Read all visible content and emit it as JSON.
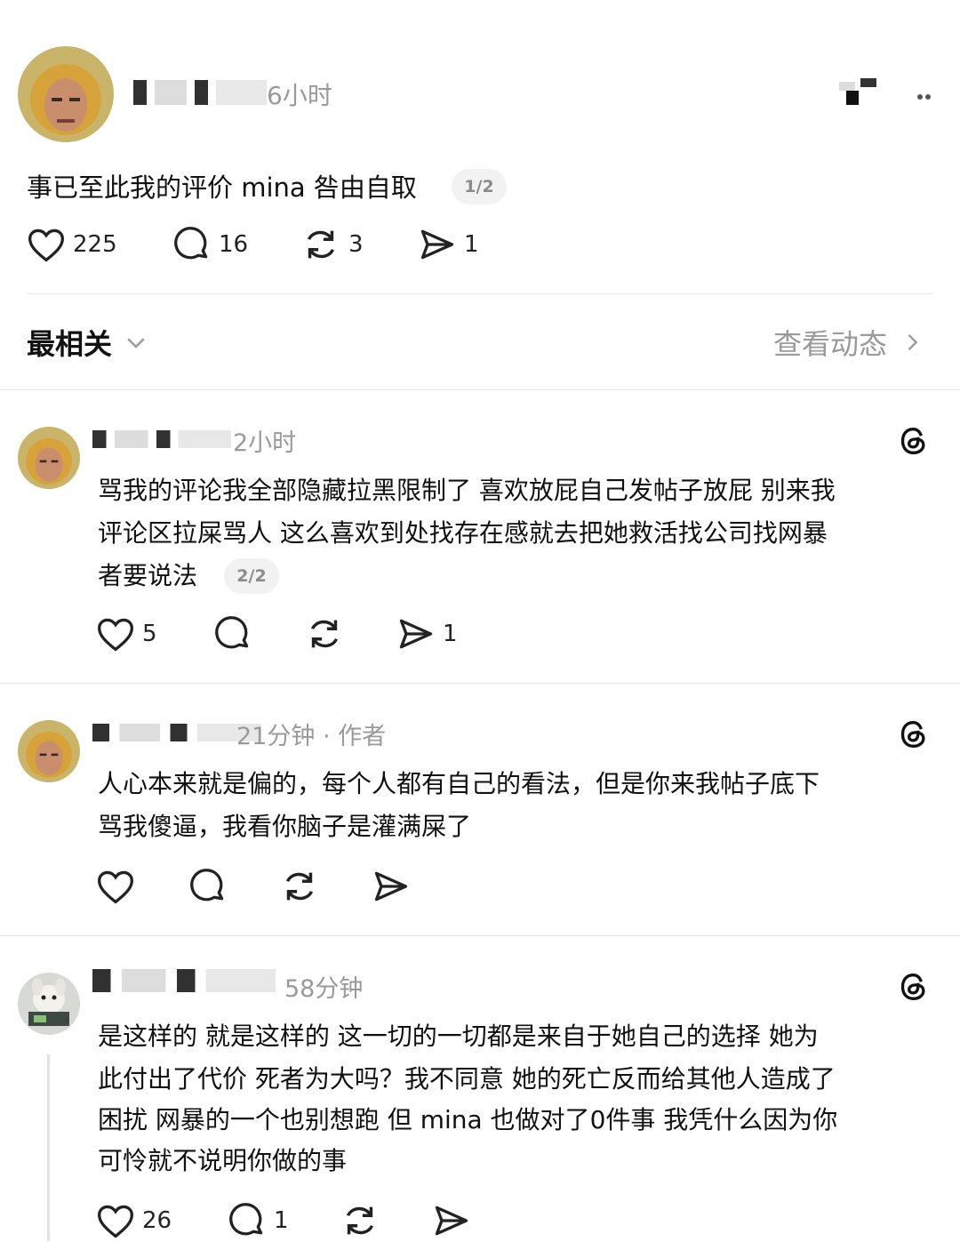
{
  "post": {
    "time": "6小时",
    "text": "事已至此我的评价 mina 咎由自取",
    "page": "1/2",
    "likes": "225",
    "comments": "16",
    "reposts": "3",
    "shares": "1"
  },
  "sort": {
    "label": "最相关",
    "view_activity": "查看动态"
  },
  "replies": [
    {
      "time": "2小时",
      "text_lines": [
        "骂我的评论我全部隐藏拉黑限制了 喜欢放屁自己发帖子放屁 别来我",
        "评论区拉屎骂人 这么喜欢到处找存在感就去把她救活找公司找网暴",
        "者要说法"
      ],
      "page": "2/2",
      "likes": "5",
      "shares": "1"
    },
    {
      "time": "21分钟 · 作者",
      "text_lines": [
        "人心本来就是偏的，每个人都有自己的看法，但是你来我帖子底下",
        "骂我傻逼，我看你脑子是灌满屎了"
      ]
    },
    {
      "time": "58分钟",
      "text_lines": [
        "是这样的 就是这样的 这一切的一切都是来自于她自己的选择 她为",
        "此付出了代价 死者为大吗？我不同意 她的死亡反而给其他人造成了",
        "困扰 网暴的一个也别想跑 但 mina 也做对了0件事 我凭什么因为你",
        "可怜就不说明你做的事"
      ],
      "likes": "26",
      "comments": "1"
    }
  ],
  "icons": {
    "heart": "heart-icon",
    "comment": "comment-icon",
    "repost": "repost-icon",
    "share": "share-icon",
    "threads": "threads-icon",
    "chevron": "chevron-down-icon"
  }
}
